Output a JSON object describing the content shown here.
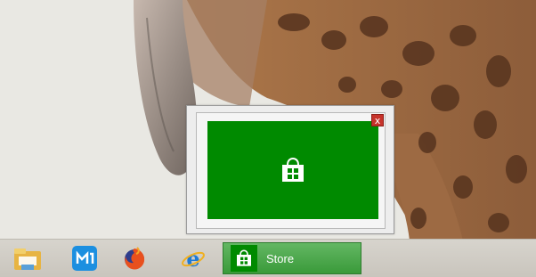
{
  "wallpaper": {
    "subject": "giraffe"
  },
  "thumbnail": {
    "app_icon": "store-bag-icon",
    "close_glyph": "x",
    "background": "#008a00"
  },
  "taskbar": {
    "pinned": [
      {
        "name": "file-explorer-icon"
      },
      {
        "name": "maxthon-browser-icon"
      },
      {
        "name": "firefox-icon"
      },
      {
        "name": "internet-explorer-icon"
      }
    ],
    "active_app": {
      "label": "Store",
      "icon": "store-bag-icon",
      "color": "#008a00"
    }
  }
}
